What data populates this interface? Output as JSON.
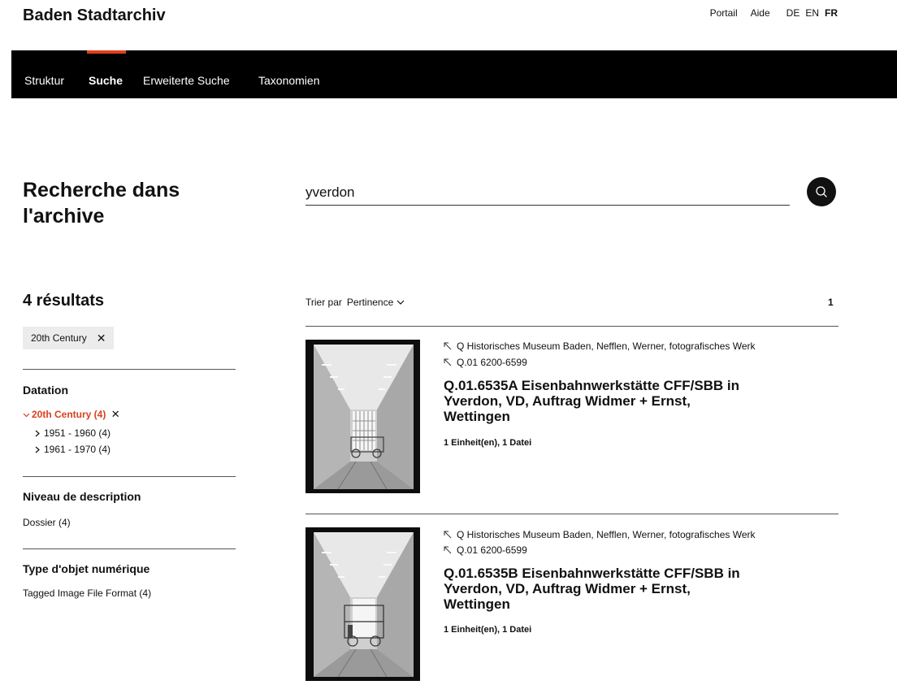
{
  "header": {
    "site_title": "Baden Stadtarchiv",
    "links": [
      "Portail",
      "Aide"
    ],
    "languages": [
      "DE",
      "EN",
      "FR"
    ],
    "active_language": "FR"
  },
  "nav": {
    "items": [
      "Struktur",
      "Suche",
      "Erweiterte Suche",
      "Taxonomien"
    ],
    "active": "Suche",
    "accent_color": "#e0401c"
  },
  "search": {
    "title": "Recherche dans l'archive",
    "query": "yverdon"
  },
  "results": {
    "count_label": "4 résultats",
    "active_filter": "20th Century",
    "sort_label": "Trier par",
    "sort_value": "Pertinence",
    "page": "1",
    "items": [
      {
        "crumb1": "Q Historisches Museum Baden, Nefflen, Werner, fotografisches Werk",
        "crumb2": "Q.01 6200-6599",
        "title": "Q.01.6535A Eisenbahnwerkstätte CFF/SBB in Yverdon, VD, Auftrag Widmer + Ernst, Wettingen",
        "meta": "1 Einheit(en), 1 Datei"
      },
      {
        "crumb1": "Q Historisches Museum Baden, Nefflen, Werner, fotografisches Werk",
        "crumb2": "Q.01 6200-6599",
        "title": "Q.01.6535B Eisenbahnwerkstätte CFF/SBB in Yverdon, VD, Auftrag Widmer + Ernst, Wettingen",
        "meta": "1 Einheit(en), 1 Datei"
      }
    ]
  },
  "facets": {
    "datation": {
      "heading": "Datation",
      "active": "20th Century (4)",
      "children": [
        "1951 - 1960 (4)",
        "1961 - 1970 (4)"
      ]
    },
    "level": {
      "heading": "Niveau de description",
      "items": [
        "Dossier (4)"
      ]
    },
    "object_type": {
      "heading": "Type d'objet numérique",
      "items": [
        "Tagged Image File Format (4)"
      ]
    }
  },
  "icons": {
    "close": "close-icon",
    "search": "search-icon",
    "chevron_down": "chevron-down-icon",
    "chevron_right": "chevron-right-icon",
    "arrow_up_left": "arrow-up-left-icon"
  }
}
